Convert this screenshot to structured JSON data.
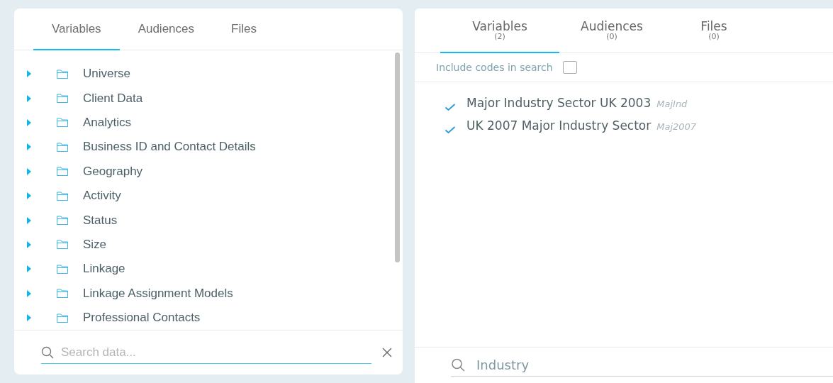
{
  "left_panel": {
    "tabs": [
      {
        "label": "Variables",
        "selected": true
      },
      {
        "label": "Audiences",
        "selected": false
      },
      {
        "label": "Files",
        "selected": false
      }
    ],
    "tree": [
      {
        "label": "Universe",
        "expanded": false
      },
      {
        "label": "Client Data",
        "expanded": false
      },
      {
        "label": "Analytics",
        "expanded": false
      },
      {
        "label": "Business ID and Contact Details",
        "expanded": false
      },
      {
        "label": "Geography",
        "expanded": false
      },
      {
        "label": "Activity",
        "expanded": false
      },
      {
        "label": "Status",
        "expanded": false
      },
      {
        "label": "Size",
        "expanded": false
      },
      {
        "label": "Linkage",
        "expanded": false
      },
      {
        "label": "Linkage Assignment Models",
        "expanded": false
      },
      {
        "label": "Professional Contacts",
        "expanded": false
      }
    ],
    "search": {
      "placeholder": "Search data..."
    }
  },
  "right_panel": {
    "tabs": [
      {
        "label": "Variables",
        "count": "(2)",
        "selected": true
      },
      {
        "label": "Audiences",
        "count": "(0)",
        "selected": false
      },
      {
        "label": "Files",
        "count": "(0)",
        "selected": false
      }
    ],
    "include_codes": {
      "label": "Include codes in search",
      "checked": false
    },
    "results": [
      {
        "name": "Major Industry Sector UK 2003",
        "code": "MajInd",
        "checked": true
      },
      {
        "name": "UK 2007 Major Industry Sector",
        "code": "Maj2007",
        "checked": true
      }
    ],
    "search": {
      "value": "Industry"
    }
  }
}
